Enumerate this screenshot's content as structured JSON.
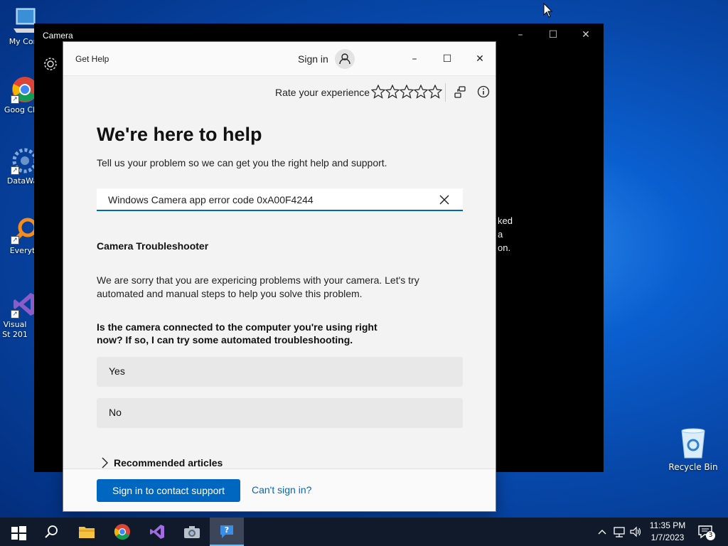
{
  "desktop": {
    "icons": [
      {
        "label": "My Com",
        "icon": "computer-icon"
      },
      {
        "label": "Goog Chro",
        "icon": "chrome-icon"
      },
      {
        "label": "DataWag",
        "icon": "datawag-icon"
      },
      {
        "label": "Everyth",
        "icon": "everything-search-icon"
      },
      {
        "label": "Visual St 201",
        "icon": "visual-studio-icon"
      }
    ],
    "recycle_bin": {
      "label": "Recycle Bin",
      "icon": "recycle-bin-icon"
    }
  },
  "camera_window": {
    "title": "Camera",
    "partial_text": [
      "ked",
      "a",
      "on."
    ]
  },
  "help_window": {
    "app_title": "Get Help",
    "sign_in_label": "Sign in",
    "rate_label": "Rate your experience",
    "star_count": 5,
    "heading": "We're here to help",
    "subheading": "Tell us your problem so we can get you the right help and support.",
    "search": {
      "value": "Windows Camera app error code 0xA00F4244"
    },
    "troubleshooter": {
      "title": "Camera Troubleshooter",
      "body": "We are sorry that you are expericing problems with your camera. Let's try automated and manual steps to help you solve this problem.",
      "question": "Is the camera connected to the computer you're using right now? If so, I can try some automated troubleshooting.",
      "options": [
        "Yes",
        "No"
      ]
    },
    "recommended_articles": "Recommended articles",
    "footer": {
      "primary_button": "Sign in to contact support",
      "secondary_link": "Can't sign in?"
    }
  },
  "taskbar": {
    "apps": [
      "start-icon",
      "search-icon",
      "file-explorer-icon",
      "chrome-icon",
      "visual-studio-icon",
      "camera-icon",
      "get-help-icon"
    ],
    "active_app": "get-help-icon",
    "clock": {
      "time": "11:35 PM",
      "date": "1/7/2023"
    },
    "notification_count": "3"
  },
  "colors": {
    "accent": "#0067c0",
    "desktop": "#0a5fcf",
    "taskbar": "#101a2a"
  }
}
